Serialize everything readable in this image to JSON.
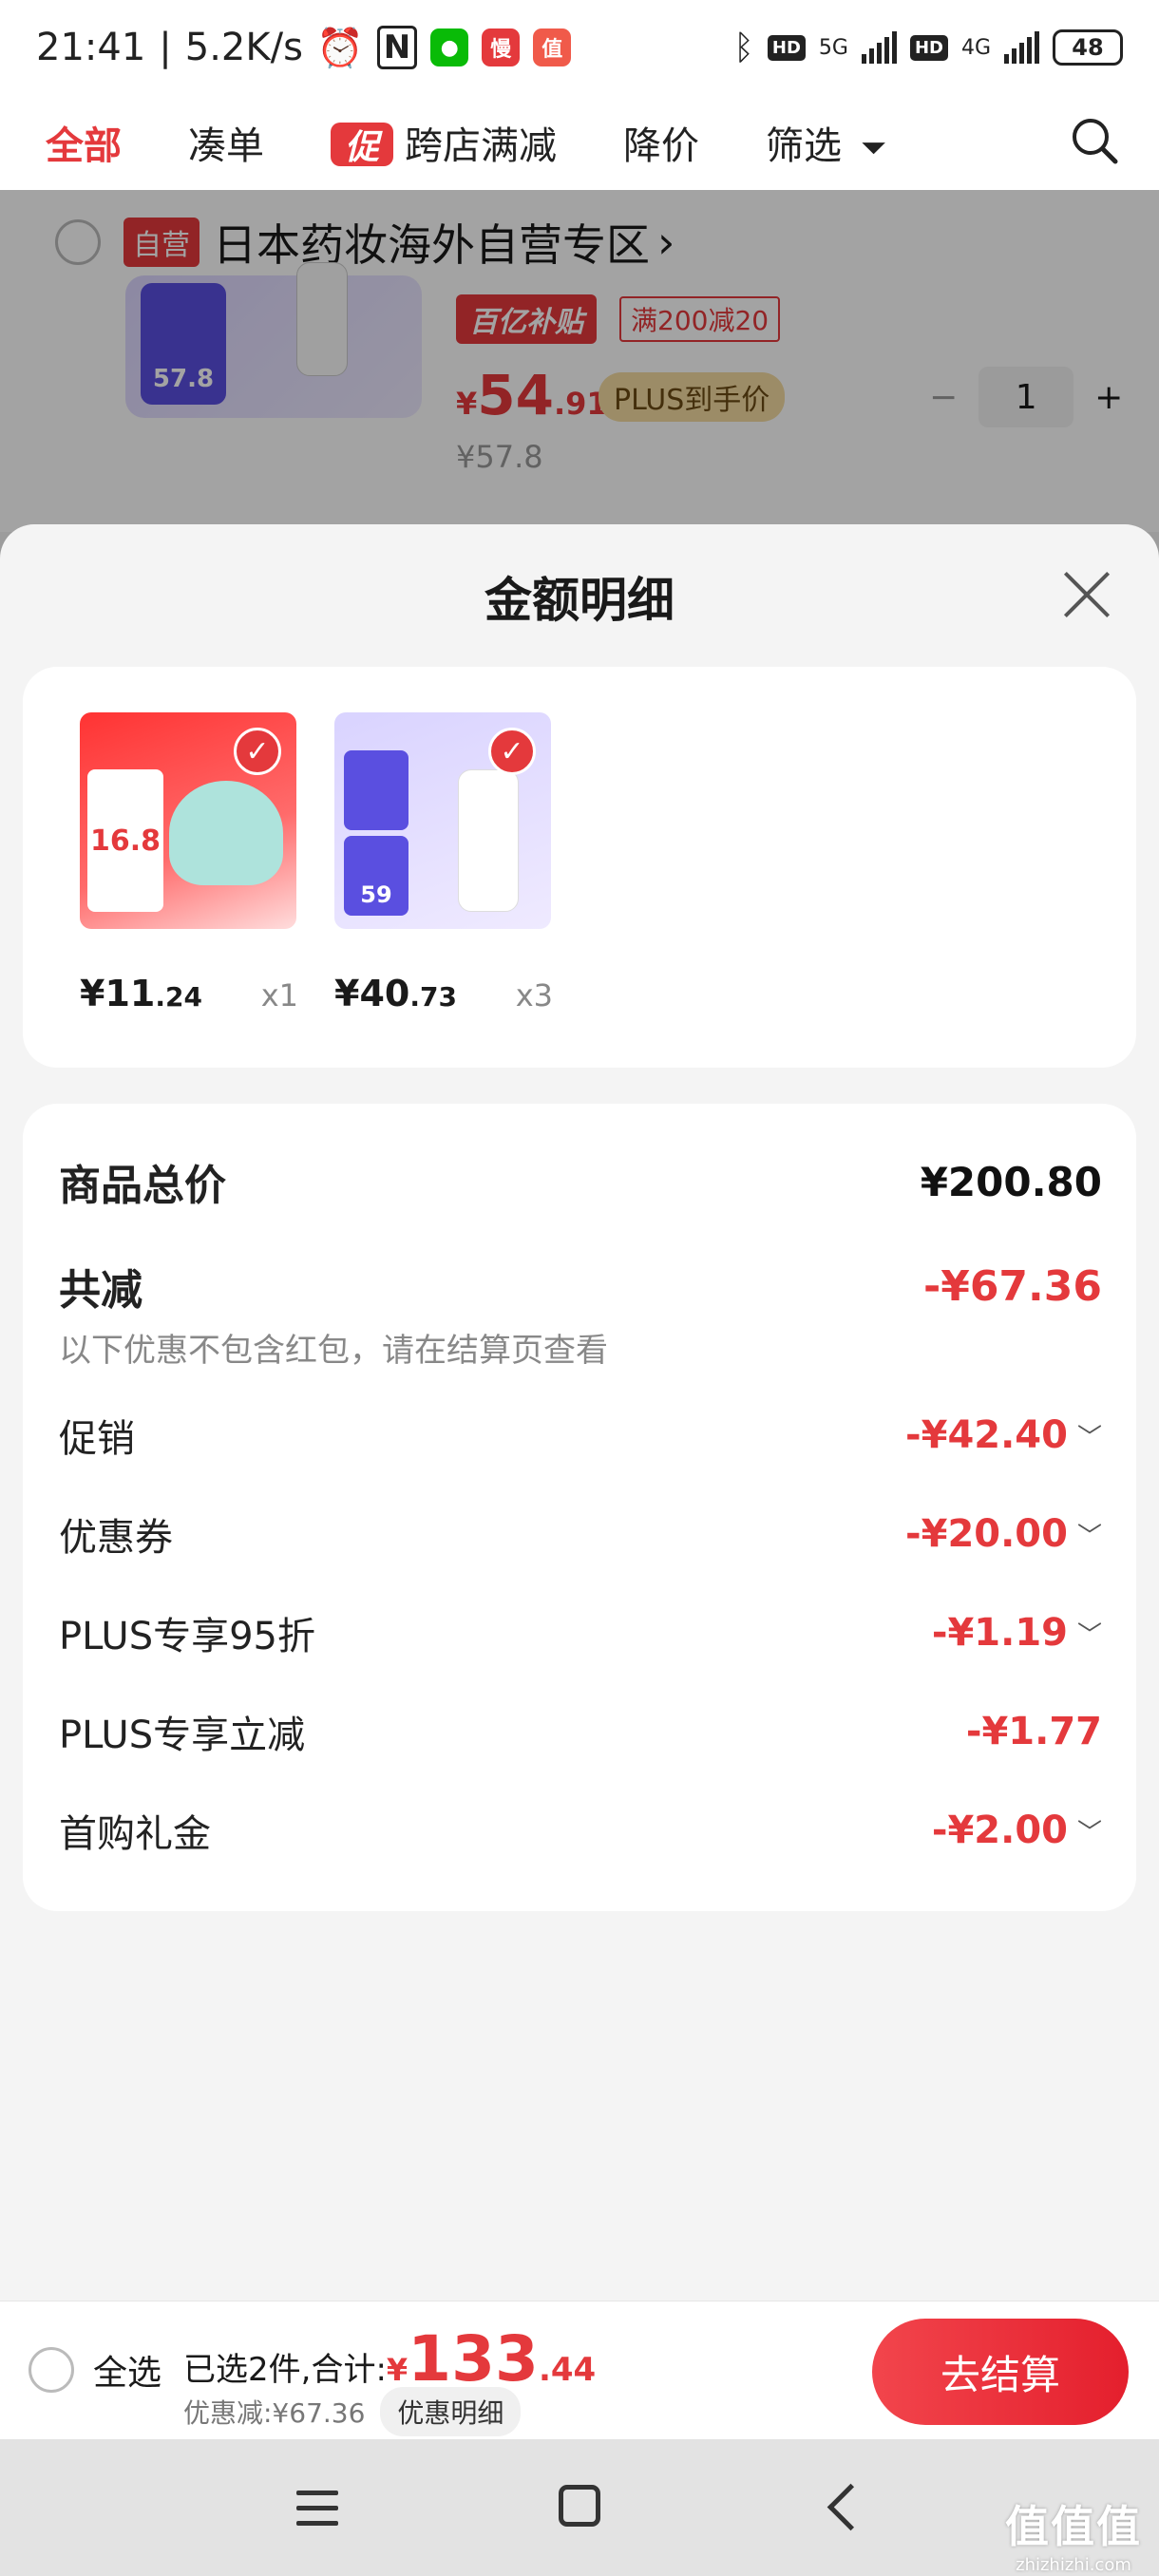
{
  "status_bar": {
    "time": "21:41",
    "speed": "5.2K/s",
    "app1": "慢",
    "app2": "值",
    "net1": "5G",
    "net2": "4G",
    "hd": "HD",
    "battery": "48"
  },
  "tabs": [
    {
      "label": "全部",
      "active": true
    },
    {
      "label": "凑单"
    },
    {
      "label": "跨店满减",
      "badge": "促"
    },
    {
      "label": "降价"
    },
    {
      "label": "筛选"
    }
  ],
  "behind": {
    "shop_tag": "自营",
    "shop_name": "日本药妆海外自营专区",
    "shop_chevron": "›",
    "img_price_label": "57.8",
    "subsidy_tag": "百亿补贴",
    "promo_tag": "满200减20",
    "price_symbol": "¥",
    "price_int": "54",
    "price_dec": ".91",
    "plus_tag": "PLUS到手价",
    "qty_minus": "−",
    "qty": "1",
    "qty_plus": "+",
    "old_price": "¥57.8"
  },
  "sheet": {
    "title": "金额明细",
    "items": [
      {
        "thumb_label": "16.8",
        "price_int": "¥11",
        "price_dec": ".24",
        "count": "x1"
      },
      {
        "thumb_label": "59",
        "price_int": "¥40",
        "price_dec": ".73",
        "count": "x3"
      }
    ],
    "check_mark": "✓",
    "total_label": "商品总价",
    "total_value": "¥200.80",
    "reduce_label": "共减",
    "reduce_value": "-¥67.36",
    "note": "以下优惠不包含红包，请在结算页查看",
    "discounts": [
      {
        "label": "促销",
        "value": "-¥42.40",
        "chev": "﹀"
      },
      {
        "label": "优惠券",
        "value": "-¥20.00",
        "chev": "﹀"
      },
      {
        "label": "PLUS专享95折",
        "value": "-¥1.19",
        "chev": "﹀"
      },
      {
        "label": "PLUS专享立减",
        "value": "-¥1.77",
        "chev": ""
      },
      {
        "label": "首购礼金",
        "value": "-¥2.00",
        "chev": "﹀"
      }
    ]
  },
  "bottom": {
    "select_all": "全选",
    "selected_text": "已选2件,合计:",
    "sum_symbol": "¥",
    "sum_int": "133",
    "sum_dec": ".44",
    "discount_text": "优惠减:¥67.36",
    "detail_button": "优惠明细",
    "checkout": "去结算"
  },
  "watermark": {
    "line1": "值值值",
    "line2": "zhizhizhi.com"
  },
  "colors": {
    "accent": "#e4393c",
    "plus_gold": "#f4dca2"
  },
  "icons": [
    "alarm-icon",
    "nfc-icon",
    "wechat-icon",
    "bluetooth-icon",
    "filter-icon",
    "search-icon",
    "close-icon",
    "check-icon",
    "chevron-down-icon",
    "menu-icon",
    "home-icon",
    "back-icon"
  ]
}
